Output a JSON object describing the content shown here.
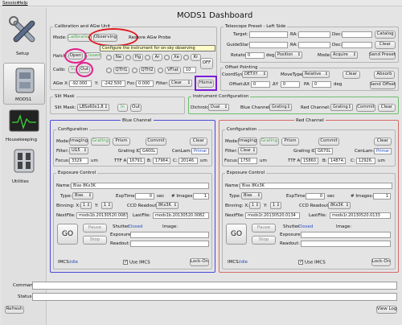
{
  "menu": [
    "Session",
    "Help"
  ],
  "title": "MODS1 Dashboard",
  "sidebar": {
    "items": [
      {
        "label": "Setup"
      },
      {
        "label": "MODS1"
      },
      {
        "label": "Housekeeping"
      },
      {
        "label": "Utilities"
      }
    ]
  },
  "calib": {
    "title": "Calibration and AGw Unit",
    "mode_label": "Mode:",
    "mode_cal": "Calibration",
    "mode_obs": "Observing",
    "restore": "Restore AGw Probe",
    "tooltip": "Configure the instrument for on-sky observing",
    "hatch_label": "Hatch:",
    "hatch_open": "Open",
    "hatch_closed": "Closed",
    "calib_label": "Calib:",
    "calib_in": "In",
    "calib_out": "Out",
    "lamps_row1": [
      "Ne",
      "Hg",
      "Ar",
      "Xe",
      "Kr"
    ],
    "lamps_row2": [
      "QTH1",
      "QTH2",
      "VFlat"
    ],
    "vflat_value": "10",
    "off": "OFF",
    "agw_label": "AGw X:",
    "agw_x": "-92.000",
    "y_label": "Y:",
    "agw_y": "-242.500",
    "foc_label": "Foc:",
    "agw_foc": "0.000",
    "filter_label": "Filter:",
    "filter_value": "Clear",
    "home": "Home"
  },
  "telescope": {
    "title": "Telescope Preset - Left Side",
    "target": "Target:",
    "ra": "RA:",
    "dec": "Dec:",
    "catalog": "Catalog",
    "guidestar": "GuideStar:",
    "clear": "Clear",
    "rotator": "Rotator:",
    "rot_value": "0",
    "deg": "deg",
    "rot_mode": "Position",
    "mode_label": "Mode:",
    "mode_value": "Acquire",
    "send_preset": "Send Preset"
  },
  "offset": {
    "title": "Offset Pointing",
    "coordsys_label": "CoordSys:",
    "coordsys": "DETXY",
    "movetype_label": "MoveType:",
    "movetype": "Relative",
    "clear": "Clear",
    "absorb": "Absorb",
    "offset_label": "Offset:",
    "dx": "ΔX",
    "dx_val": "0",
    "dy": "ΔY",
    "dy_val": "0",
    "pa": "PA",
    "pa_val": "0",
    "deg": "deg",
    "send": "Send Offset"
  },
  "slitmask": {
    "title": "Slit Mask",
    "label": "Slit Mask:",
    "value": "LBSx60x1.8",
    "in": "In",
    "out": "Out"
  },
  "instconfig": {
    "title": "Instrument Configuration",
    "dichroic_label": "Dichroic:",
    "dichroic": "Dual",
    "blue_label": "Blue Channel:",
    "blue": "Grating",
    "red_label": "Red Channel:",
    "red": "Grating",
    "commit": "Commit",
    "clear": "Clear"
  },
  "blue": {
    "title": "Blue Channel",
    "config": "Configuration",
    "mode_label": "Mode:",
    "modes": [
      "Imaging",
      "Grating",
      "Prism"
    ],
    "commit": "Commit",
    "clear": "Clear",
    "filter_label": "Filter:",
    "filter": "UG5",
    "grating_label": "Grating ID:",
    "grating": "G400L",
    "cenlam_label": "CenLam:",
    "cenlam": "Primar",
    "focus_label": "Focus:",
    "focus": "3329",
    "um": "um",
    "tta_label": "TTF A:",
    "tta": "16791.",
    "b_label": "B:",
    "b": "17964.",
    "c_label": "C:",
    "c": "20146.",
    "um2": "um",
    "exposure": "Exposure Control",
    "name_label": "Name:",
    "name": "Bias 8Kx3K",
    "type_label": "Type:",
    "type": "Bias",
    "exptime_label": "ExpTime",
    "exptime": "0",
    "sec": "sec",
    "nimages_label": "# Images:",
    "nimages": "1",
    "binx_label": "Binning: X:",
    "binx": "1",
    "biny_label": "Y:",
    "biny": "1",
    "ccd_label": "CCD Readout:",
    "ccd": "8Kx3K",
    "next_label": "NextFile:",
    "next": "mods1b.20130520.0083",
    "last_label": "LastFile:",
    "last": "mods1b.20130520.0082",
    "go": "GO",
    "pause": "Pause",
    "stop": "Stop",
    "shutter_label": "Shutter:",
    "shutter": "Closed",
    "image_label": "Image:",
    "exposure_label": "Exposure:",
    "readout_label": "Readout:",
    "imcs_label": "IMCS:",
    "imcs": "Idle",
    "use_imcs": "Use IMCS",
    "lockon": "Lock-On"
  },
  "red": {
    "title": "Red Channel",
    "config": "Configuration",
    "mode_label": "Mode:",
    "modes": [
      "Imaging",
      "Grating",
      "Prism"
    ],
    "commit": "Commit",
    "clear": "Clear",
    "filter_label": "Filter:",
    "filter": "Clear",
    "grating_label": "Grating ID:",
    "grating": "G670L",
    "cenlam_label": "CenLam:",
    "cenlam": "Primar",
    "focus_label": "Focus:",
    "focus": "1750",
    "um": "um",
    "tta_label": "TTF A:",
    "tta": "15860.",
    "b_label": "B:",
    "b": "14874.",
    "c_label": "C:",
    "c": "12926.",
    "um2": "um",
    "exposure": "Exposure Control",
    "name_label": "Name:",
    "name": "Bias 8Kx3K",
    "type_label": "Type:",
    "type": "Bias",
    "exptime_label": "ExpTime",
    "exptime": "0",
    "sec": "sec",
    "nimages_label": "# Images:",
    "nimages": "1",
    "binx_label": "Binning: X:",
    "binx": "1",
    "biny_label": "Y:",
    "biny": "1",
    "ccd_label": "CCD Readout:",
    "ccd": "8Kx3K",
    "next_label": "NextFile:",
    "next": "mods1r.20130520.0134",
    "last_label": "LastFile:",
    "last": "mods1r.20130520.0133",
    "go": "GO",
    "pause": "Pause",
    "stop": "Stop",
    "shutter_label": "Shutter:",
    "shutter": "Closed",
    "image_label": "Image:",
    "exposure_label": "Exposure:",
    "readout_label": "Readout:",
    "imcs_label": "IMCS:",
    "imcs": "Idle",
    "use_imcs": "Use IMCS",
    "lockon": "Lock-On"
  },
  "bottom": {
    "command_label": "Command:",
    "status_label": "Status:",
    "refresh": "Refresh",
    "viewlog": "View Log"
  },
  "colors": {
    "highlight_red": "#e0191f",
    "highlight_magenta": "#e0208c",
    "highlight_purple": "#7a1fd8",
    "blue_frame": "#4a4ad8",
    "red_frame": "#d86a6a",
    "green_frame": "#6fbf6f"
  }
}
